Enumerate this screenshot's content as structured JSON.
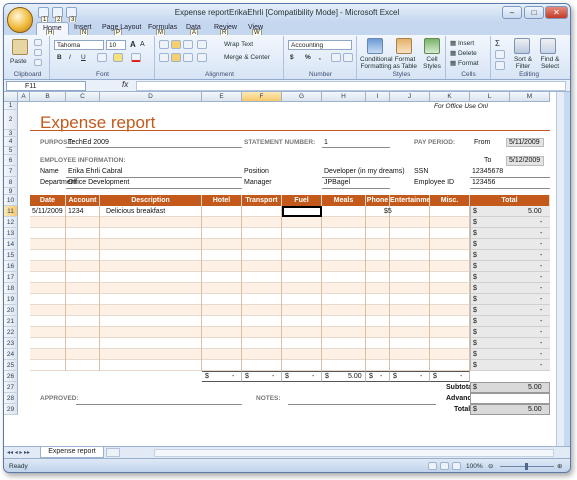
{
  "window": {
    "title": "Expense reportErikaEhrli  [Compatibility Mode]  -  Microsoft Excel",
    "min_label": "–",
    "max_label": "□",
    "close_label": "✕"
  },
  "qat_keytips": [
    "1",
    "2",
    "3"
  ],
  "tabs": [
    {
      "label": "Home",
      "key": "H"
    },
    {
      "label": "Insert",
      "key": "N"
    },
    {
      "label": "Page Layout",
      "key": "P"
    },
    {
      "label": "Formulas",
      "key": "M"
    },
    {
      "label": "Data",
      "key": "A"
    },
    {
      "label": "Review",
      "key": "R"
    },
    {
      "label": "View",
      "key": "W"
    }
  ],
  "ribbon": {
    "clipboard": {
      "label": "Clipboard",
      "paste": "Paste"
    },
    "font": {
      "label": "Font",
      "name": "Tahoma",
      "size": "10",
      "grow": "A",
      "shrink": "A",
      "bold": "B",
      "italic": "I",
      "underline": "U"
    },
    "alignment": {
      "label": "Alignment",
      "wrap": "Wrap Text",
      "merge": "Merge & Center"
    },
    "number": {
      "label": "Number",
      "format": "Accounting",
      "currency": "$",
      "percent": "%",
      "comma": ","
    },
    "styles": {
      "label": "Styles",
      "conditional": "Conditional Formatting",
      "table": "Format as Table",
      "cell": "Cell Styles"
    },
    "cells": {
      "label": "Cells",
      "insert": "Insert",
      "delete": "Delete",
      "format": "Format"
    },
    "editing": {
      "label": "Editing",
      "sigma": "Σ",
      "sort": "Sort & Filter",
      "find": "Find & Select"
    }
  },
  "formula_bar": {
    "name_box": "F11",
    "fx": "fx",
    "value": ""
  },
  "columns": [
    "A",
    "B",
    "C",
    "D",
    "E",
    "F",
    "G",
    "H",
    "I",
    "J",
    "K",
    "L",
    "M"
  ],
  "rows": [
    "1",
    "2",
    "3",
    "4",
    "5",
    "6",
    "7",
    "8",
    "9",
    "10",
    "11",
    "12",
    "13",
    "14",
    "15",
    "16",
    "17",
    "18",
    "19",
    "20",
    "21",
    "22",
    "23",
    "24",
    "25",
    "26",
    "27",
    "28",
    "29"
  ],
  "sheet": {
    "office_use": "For Office Use Onl",
    "title": "Expense report",
    "purpose_label": "PURPOSE:",
    "purpose": "TechEd 2009",
    "statement_label": "STATEMENT NUMBER:",
    "statement": "1",
    "pay_label": "PAY PERIOD:",
    "from_label": "From",
    "from": "5/11/2009",
    "to_label": "To",
    "to": "5/12/2009",
    "emp_label": "EMPLOYEE INFORMATION:",
    "name_label": "Name",
    "name": "Erika Ehrli Cabral",
    "position_label": "Position",
    "position": "Developer (in my dreams)",
    "ssn_label": "SSN",
    "ssn": "12345678",
    "dept_label": "Department",
    "dept": "Office Development",
    "manager_label": "Manager",
    "manager": "JPBagel",
    "empid_label": "Employee ID",
    "empid": "123456",
    "headers": [
      "Date",
      "Account",
      "Description",
      "Hotel",
      "Transport",
      "Fuel",
      "Meals",
      "Phone",
      "Entertainment",
      "Misc.",
      "Total"
    ],
    "row11": {
      "date": "5/11/2009",
      "account": "1234",
      "description": "Delicious breakfast",
      "meals": "$5",
      "total_cur": "$",
      "total": "5.00"
    },
    "dash": "-",
    "cur": "$",
    "totals_meals": "5.00",
    "subtotal_label": "Subtotal",
    "subtotal": "5.00",
    "advances_label": "Advances",
    "total_label": "Total",
    "total": "5.00",
    "approved_label": "APPROVED:",
    "notes_label": "NOTES:"
  },
  "sheet_tabs": [
    "Expense report"
  ],
  "status": {
    "ready": "Ready",
    "zoom": "100%"
  }
}
